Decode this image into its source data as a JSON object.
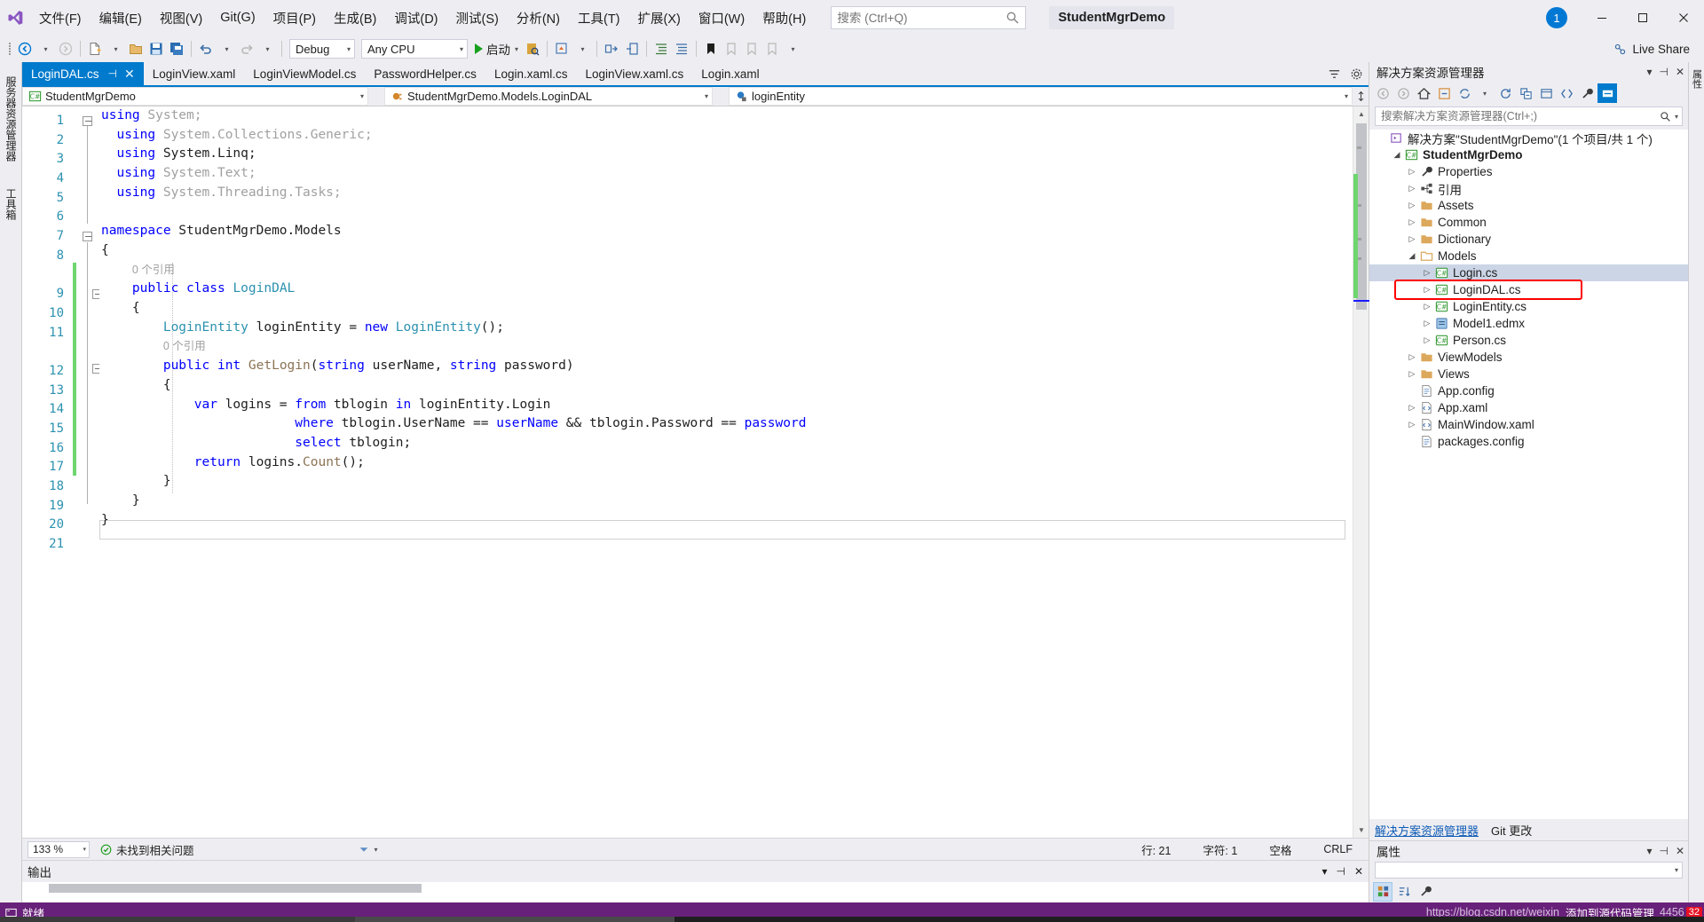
{
  "titlebar": {
    "app_icon": "visual-studio-logo",
    "menus": [
      {
        "label": "文件(F)",
        "mnemonic": "F"
      },
      {
        "label": "编辑(E)",
        "mnemonic": "E"
      },
      {
        "label": "视图(V)",
        "mnemonic": "V"
      },
      {
        "label": "Git(G)",
        "mnemonic": "G"
      },
      {
        "label": "项目(P)",
        "mnemonic": "P"
      },
      {
        "label": "生成(B)",
        "mnemonic": "B"
      },
      {
        "label": "调试(D)",
        "mnemonic": "D"
      },
      {
        "label": "测试(S)",
        "mnemonic": "S"
      },
      {
        "label": "分析(N)",
        "mnemonic": "N"
      },
      {
        "label": "工具(T)",
        "mnemonic": "T"
      },
      {
        "label": "扩展(X)",
        "mnemonic": "X"
      },
      {
        "label": "窗口(W)",
        "mnemonic": "W"
      },
      {
        "label": "帮助(H)",
        "mnemonic": "H"
      }
    ],
    "search_placeholder": "搜索 (Ctrl+Q)",
    "search_value": "",
    "solution_name": "StudentMgrDemo",
    "notification_count": "1",
    "minimize": "—",
    "maximize": "□",
    "close": "✕"
  },
  "toolbar": {
    "config": "Debug",
    "platform": "Any CPU",
    "run_label": "启动",
    "live_share": "Live Share"
  },
  "left_rail": {
    "items": [
      "服务器资源管理器",
      "工具箱"
    ]
  },
  "tabs": [
    {
      "label": "LoginDAL.cs",
      "active": true,
      "pin": "⊣",
      "close": "✕"
    },
    {
      "label": "LoginView.xaml",
      "active": false
    },
    {
      "label": "LoginViewModel.cs",
      "active": false
    },
    {
      "label": "PasswordHelper.cs",
      "active": false
    },
    {
      "label": "Login.xaml.cs",
      "active": false
    },
    {
      "label": "LoginView.xaml.cs",
      "active": false
    },
    {
      "label": "Login.xaml",
      "active": false
    }
  ],
  "navbar": {
    "project": "StudentMgrDemo",
    "project_icon": "csharp-project-icon",
    "type": "StudentMgrDemo.Models.LoginDAL",
    "type_icon": "class-icon",
    "member": "loginEntity",
    "member_icon": "field-private-icon"
  },
  "code": {
    "lines": [
      {
        "n": "1",
        "html": "<span class=\"kw\">using</span> <span class=\"gray\">System;</span>"
      },
      {
        "n": "2",
        "html": "  <span class=\"kw\">using</span> <span class=\"gray\">System.Collections.Generic;</span>"
      },
      {
        "n": "3",
        "html": "  <span class=\"kw\">using</span> System.Linq;"
      },
      {
        "n": "4",
        "html": "  <span class=\"kw\">using</span> <span class=\"gray\">System.Text;</span>"
      },
      {
        "n": "5",
        "html": "  <span class=\"kw\">using</span> <span class=\"gray\">System.Threading.Tasks;</span>"
      },
      {
        "n": "6",
        "html": ""
      },
      {
        "n": "7",
        "html": "<span class=\"kw\">namespace</span> StudentMgrDemo.Models"
      },
      {
        "n": "8",
        "html": "{"
      },
      {
        "n": "",
        "html": "    <span class=\"ref\">0 个引用</span>"
      },
      {
        "n": "9",
        "html": "    <span class=\"kw\">public</span> <span class=\"kw\">class</span> <span class=\"ty\">LoginDAL</span>"
      },
      {
        "n": "10",
        "html": "    {"
      },
      {
        "n": "11",
        "html": "        <span class=\"ty\">LoginEntity</span> loginEntity = <span class=\"kw\">new</span> <span class=\"ty\">LoginEntity</span>();"
      },
      {
        "n": "",
        "html": "        <span class=\"ref\">0 个引用</span>"
      },
      {
        "n": "12",
        "html": "        <span class=\"kw\">public</span> <span class=\"kw\">int</span> <span class=\"mth\">GetLogin</span>(<span class=\"kw\">string</span> userName, <span class=\"kw\">string</span> password)"
      },
      {
        "n": "13",
        "html": "        {"
      },
      {
        "n": "14",
        "html": "            <span class=\"kw\">var</span> logins = <span class=\"kw\">from</span> tblogin <span class=\"kw\">in</span> loginEntity.Login"
      },
      {
        "n": "15",
        "html": "                         <span class=\"kw\">where</span> tblogin.UserName == <span class=\"blu\">userName</span> &amp;&amp; tblogin.Password == <span class=\"blu\">password</span>"
      },
      {
        "n": "16",
        "html": "                         <span class=\"kw\">select</span> tblogin;"
      },
      {
        "n": "17",
        "html": "            <span class=\"kw\">return</span> logins.<span class=\"mth\">Count</span>();"
      },
      {
        "n": "18",
        "html": "        }"
      },
      {
        "n": "19",
        "html": "    }"
      },
      {
        "n": "20",
        "html": "}"
      },
      {
        "n": "21",
        "html": ""
      }
    ]
  },
  "editor_status": {
    "zoom": "133 %",
    "issues": "未找到相关问题",
    "line": "行: 21",
    "col": "字符: 1",
    "spaces": "空格",
    "eol": "CRLF"
  },
  "output": {
    "title": "输出"
  },
  "solution_explorer": {
    "title": "解决方案资源管理器",
    "search_placeholder": "搜索解决方案资源管理器(Ctrl+;)",
    "search_value": "",
    "tree": [
      {
        "indent": 0,
        "expander": "none",
        "icon": "solution-icon",
        "label": "解决方案\"StudentMgrDemo\"(1 个项目/共 1 个)",
        "bold": false,
        "selected": false
      },
      {
        "indent": 1,
        "expander": "open",
        "icon": "csharp-project-icon",
        "label": "StudentMgrDemo",
        "bold": true,
        "selected": false
      },
      {
        "indent": 2,
        "expander": "closed",
        "icon": "properties-icon",
        "label": "Properties",
        "bold": false,
        "selected": false
      },
      {
        "indent": 2,
        "expander": "closed",
        "icon": "references-icon",
        "label": "引用",
        "bold": false,
        "selected": false
      },
      {
        "indent": 2,
        "expander": "closed",
        "icon": "folder-icon",
        "label": "Assets",
        "bold": false,
        "selected": false
      },
      {
        "indent": 2,
        "expander": "closed",
        "icon": "folder-icon",
        "label": "Common",
        "bold": false,
        "selected": false
      },
      {
        "indent": 2,
        "expander": "closed",
        "icon": "folder-icon",
        "label": "Dictionary",
        "bold": false,
        "selected": false
      },
      {
        "indent": 2,
        "expander": "open",
        "icon": "folder-open-icon",
        "label": "Models",
        "bold": false,
        "selected": false
      },
      {
        "indent": 3,
        "expander": "closed",
        "icon": "csharp-file-icon",
        "label": "Login.cs",
        "bold": false,
        "selected": true
      },
      {
        "indent": 3,
        "expander": "closed",
        "icon": "csharp-file-icon",
        "label": "LoginDAL.cs",
        "bold": false,
        "selected": false,
        "highlight": true
      },
      {
        "indent": 3,
        "expander": "closed",
        "icon": "csharp-file-icon",
        "label": "LoginEntity.cs",
        "bold": false,
        "selected": false
      },
      {
        "indent": 3,
        "expander": "closed",
        "icon": "edmx-icon",
        "label": "Model1.edmx",
        "bold": false,
        "selected": false
      },
      {
        "indent": 3,
        "expander": "closed",
        "icon": "csharp-file-icon",
        "label": "Person.cs",
        "bold": false,
        "selected": false
      },
      {
        "indent": 2,
        "expander": "closed",
        "icon": "folder-icon",
        "label": "ViewModels",
        "bold": false,
        "selected": false
      },
      {
        "indent": 2,
        "expander": "closed",
        "icon": "folder-icon",
        "label": "Views",
        "bold": false,
        "selected": false
      },
      {
        "indent": 2,
        "expander": "none",
        "icon": "config-icon",
        "label": "App.config",
        "bold": false,
        "selected": false
      },
      {
        "indent": 2,
        "expander": "closed",
        "icon": "xaml-icon",
        "label": "App.xaml",
        "bold": false,
        "selected": false
      },
      {
        "indent": 2,
        "expander": "closed",
        "icon": "xaml-icon",
        "label": "MainWindow.xaml",
        "bold": false,
        "selected": false
      },
      {
        "indent": 2,
        "expander": "none",
        "icon": "config-icon",
        "label": "packages.config",
        "bold": false,
        "selected": false
      }
    ],
    "bottom_tabs": [
      {
        "label": "解决方案资源管理器",
        "active": true
      },
      {
        "label": "Git 更改",
        "active": false
      }
    ]
  },
  "properties_pane": {
    "title": "属性"
  },
  "far_rail": {
    "items": [
      "属性"
    ]
  },
  "statusbar": {
    "ready": "就绪",
    "watermark": "https://blog.csdn.net/weixin_",
    "watermark2": "添加到源代码管理",
    "watermark3": "4456",
    "watermark_badge": "32"
  },
  "colors": {
    "accent": "#007acc",
    "status_purple": "#68217a",
    "keyword_blue": "#0000ff",
    "type_teal": "#2b91af",
    "method_tan": "#8b7355",
    "annotation_red": "#ff0000",
    "change_green": "#6ed66e"
  }
}
